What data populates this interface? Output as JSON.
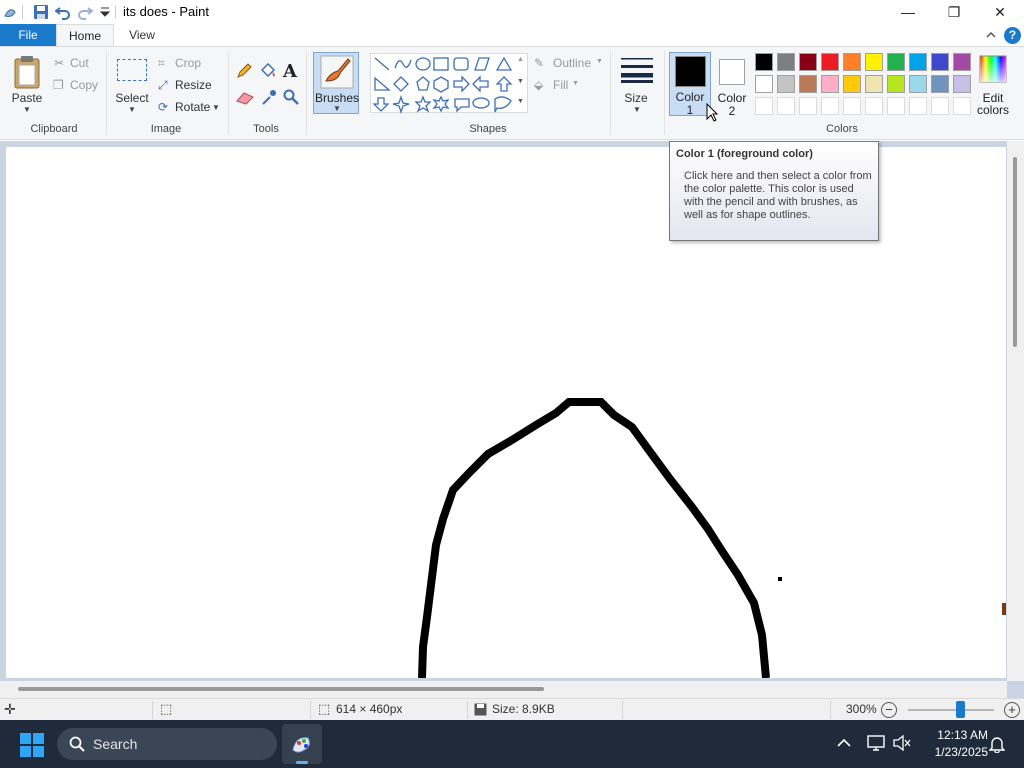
{
  "titlebar": {
    "title": "its does - Paint",
    "minimize_glyph": "—",
    "maximize_glyph": "❐",
    "close_glyph": "✕"
  },
  "tabs": {
    "file": "File",
    "home": "Home",
    "view": "View"
  },
  "clipboard": {
    "paste": "Paste",
    "cut": "Cut",
    "copy": "Copy",
    "label": "Clipboard"
  },
  "image": {
    "select": "Select",
    "crop": "Crop",
    "resize": "Resize",
    "rotate": "Rotate",
    "label": "Image"
  },
  "tools": {
    "label": "Tools"
  },
  "brushes": {
    "label": "Brushes"
  },
  "shapes": {
    "outline": "Outline",
    "fill": "Fill",
    "label": "Shapes"
  },
  "size": {
    "label": "Size"
  },
  "colors": {
    "color1_line1": "Color",
    "color1_line2": "1",
    "color2_line1": "Color",
    "color2_line2": "2",
    "edit_line1": "Edit",
    "edit_line2": "colors",
    "label": "Colors",
    "color1_value": "#000000",
    "color2_value": "#ffffff",
    "palette_row1": [
      "#000000",
      "#7f7f7f",
      "#880015",
      "#ed1c24",
      "#ff7f27",
      "#fff200",
      "#22b14c",
      "#00a2e8",
      "#3f48cc",
      "#a349a4"
    ],
    "palette_row2": [
      "#ffffff",
      "#c3c3c3",
      "#b97a57",
      "#ffaec9",
      "#ffc90e",
      "#efe4b0",
      "#b5e61d",
      "#99d9ea",
      "#7092be",
      "#c8bfe7"
    ]
  },
  "tooltip": {
    "title": "Color 1 (foreground color)",
    "body": "Click here and then select a color from the color palette. This color is used with the pencil  and with brushes, as well as for shape outlines."
  },
  "status": {
    "dimensions": "614 × 460px",
    "size": "Size: 8.9KB",
    "zoom": "300%"
  },
  "taskbar": {
    "search": "Search",
    "time": "12:13 AM",
    "date": "1/23/2025"
  }
}
